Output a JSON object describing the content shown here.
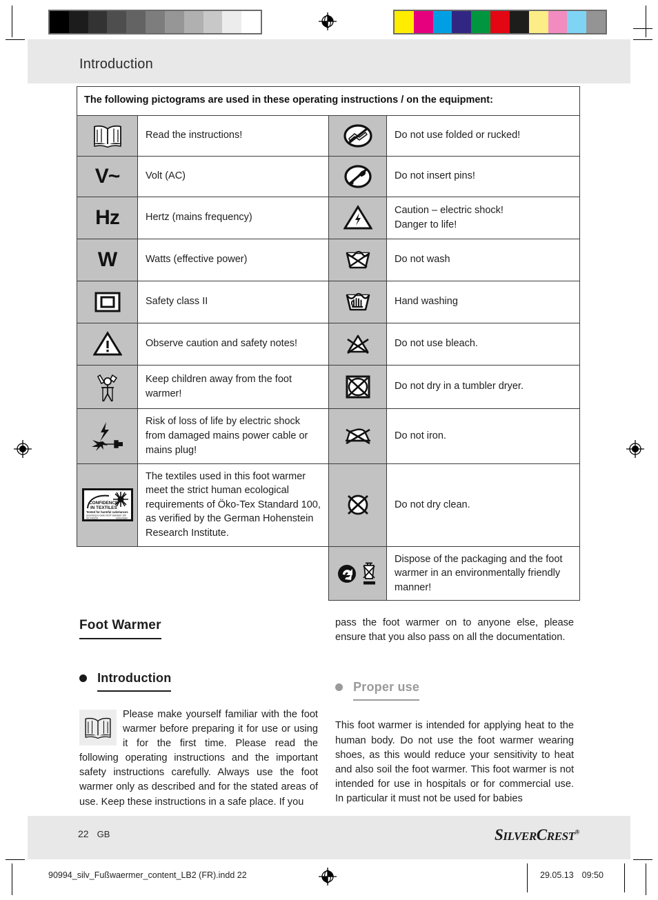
{
  "header": {
    "title": "Introduction"
  },
  "calibration": {
    "gray_bar": [
      "#000000",
      "#1c1c1c",
      "#333333",
      "#4e4e4e",
      "#636363",
      "#7d7d7d",
      "#969696",
      "#b0b0b0",
      "#c8c8c8",
      "#ececec",
      "#ffffff"
    ],
    "color_bar": [
      "#ffed00",
      "#e6007e",
      "#009fe3",
      "#312783",
      "#009640",
      "#e30613",
      "#1d1d1b",
      "#fced86",
      "#f28cc0",
      "#7fd4f4",
      "#949494"
    ]
  },
  "table": {
    "heading": "The following pictograms are used in these operating instructions / on the equipment:",
    "rows": [
      {
        "left_icon": "open-book-icon",
        "left_text": "Read the instructions!",
        "right_icon": "do-not-use-folded-icon",
        "right_text": "Do not use folded or rucked!"
      },
      {
        "left_icon": "volt-ac-symbol",
        "left_text": "Volt (AC)",
        "right_icon": "do-not-insert-pins-icon",
        "right_text": "Do not insert pins!"
      },
      {
        "left_icon": "hertz-symbol",
        "left_text": "Hertz (mains frequency)",
        "right_icon": "electric-shock-warning-icon",
        "right_text": "Caution – electric shock!\nDanger to life!"
      },
      {
        "left_icon": "watt-symbol",
        "left_text": "Watts (effective power)",
        "right_icon": "do-not-wash-icon",
        "right_text": "Do not wash"
      },
      {
        "left_icon": "safety-class-two-icon",
        "left_text": "Safety class II",
        "right_icon": "hand-washing-icon",
        "right_text": "Hand washing"
      },
      {
        "left_icon": "warning-triangle-icon",
        "left_text": "Observe caution and safety notes!",
        "right_icon": "do-not-bleach-icon",
        "right_text": "Do not use bleach."
      },
      {
        "left_icon": "keep-children-away-icon",
        "left_text": "Keep children away from the foot warmer!",
        "right_icon": "do-not-tumble-dry-icon",
        "right_text": "Do not dry in a tumbler dryer."
      },
      {
        "left_icon": "damaged-cable-shock-icon",
        "left_text": "Risk of loss of life by electric shock from damaged mains power cable or mains plug!",
        "right_icon": "do-not-iron-icon",
        "right_text": "Do not iron."
      },
      {
        "left_icon": "oeko-tex-label-icon",
        "left_text": "The textiles used in this foot warmer meet the strict human ecological requirements of Öko-Tex Standard 100, as verified by the German Hohenstein Research Institute.",
        "right_icon": "do-not-dry-clean-icon",
        "right_text": "Do not dry clean."
      },
      {
        "left_icon": "",
        "left_text": "",
        "right_icon": "recycle-and-weee-icon",
        "right_text": "Dispose of the packaging and the foot warmer in an environmentally friendly manner!"
      }
    ],
    "oeko_tex_label": {
      "line1": "CONFIDENCE",
      "line2": "IN TEXTILES",
      "line3": "Tested for harmful substances",
      "line4": "according to Oeko-Tex® Standard 100",
      "line5": "06.0.40314",
      "line6": "Hohenstein"
    }
  },
  "content": {
    "product_title": "Foot Warmer",
    "left_section": {
      "heading": "Introduction",
      "icon": "open-book-icon",
      "paragraph": "Please make yourself familiar with the foot warmer before preparing it for use or using it for the first time. Please read the following operating instructions and the important safety instructions carefully. Always use the foot warmer only as described and for the stated areas of use. Keep these instructions in a safe place. If you"
    },
    "right_top_paragraph": "pass the foot warmer on to anyone else, please ensure that you also pass on all the documentation.",
    "right_section": {
      "heading": "Proper use",
      "heading_color": "#9a9a9a",
      "paragraph": "This foot warmer is intended for applying heat to the human body. Do not use the foot warmer wearing shoes, as this would reduce your sensitivity to heat and also soil the foot warmer. This foot warmer is not intended for use in hospitals or for commercial use. In particular it must not be used for babies"
    }
  },
  "footer": {
    "page_number": "22",
    "language_code": "GB",
    "brand_part1": "S",
    "brand_part2": "ILVER",
    "brand_part3": "C",
    "brand_part4": "REST",
    "brand_mark": "®",
    "print_filename": "90994_silv_Fußwaermer_content_LB2 (FR).indd   22",
    "print_date": "29.05.13",
    "print_time": "09:50"
  }
}
